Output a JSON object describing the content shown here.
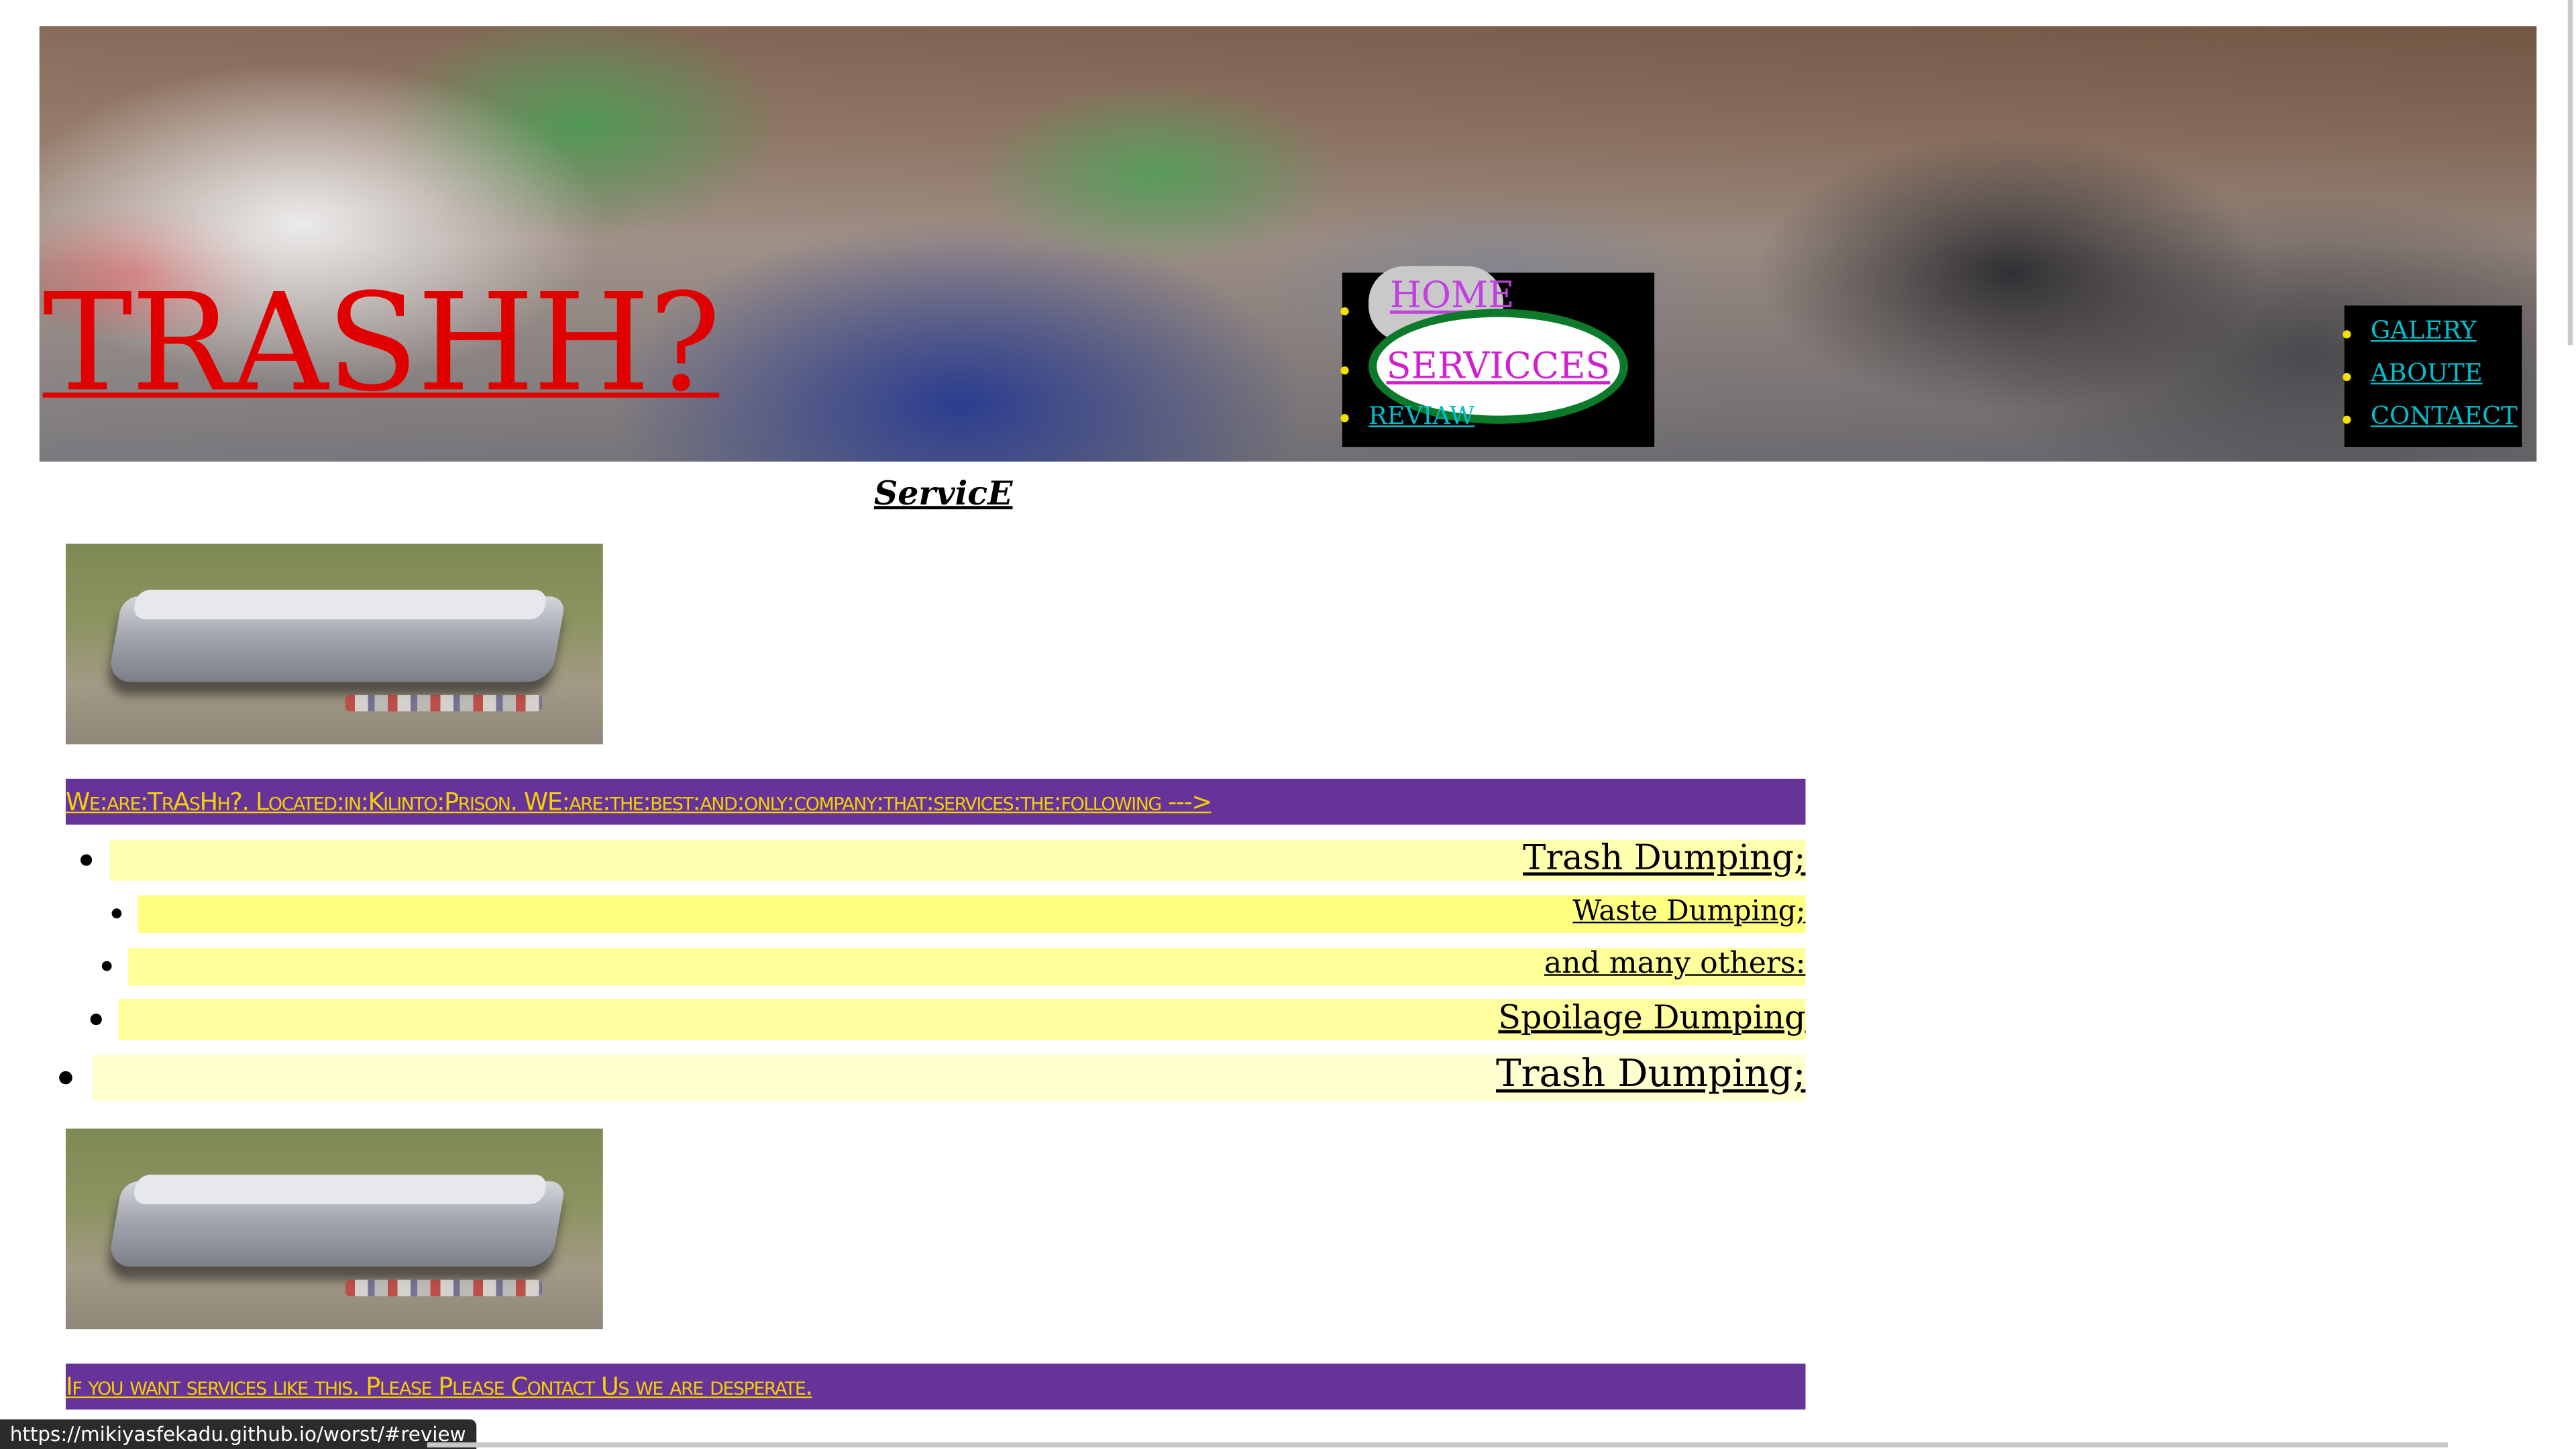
{
  "header": {
    "logo": "TRASHH?",
    "nav_left": {
      "home": "HOME",
      "services": "SERVICCES",
      "review": "REVIAW"
    },
    "nav_right": {
      "gallery": "GALERY",
      "about": "ABOUTE",
      "contact": "CONTAECT"
    }
  },
  "main": {
    "section_title": "ServicE",
    "intro_banner": "We:are:TrAsHh?. Located:in:Kilinto:Prison. WE:are:the:best:and:only:company:that:services:the:following --->",
    "services": [
      "Trash Dumping;",
      "Waste Dumping;",
      "and many others:",
      "Spoilage Dumping",
      "Trash Dumping;"
    ],
    "contact_banner": "If you want services like this. Please Please Contact Us we are desperate."
  },
  "status_bar": {
    "url": "https://mikiyasfekadu.github.io/worst/#review"
  },
  "colors": {
    "logo": "#e00000",
    "nav_background": "#000000",
    "nav_link": "#00c0d0",
    "banner_background": "#663399",
    "banner_text": "#f5d000",
    "service_highlight": "#ffff99"
  }
}
